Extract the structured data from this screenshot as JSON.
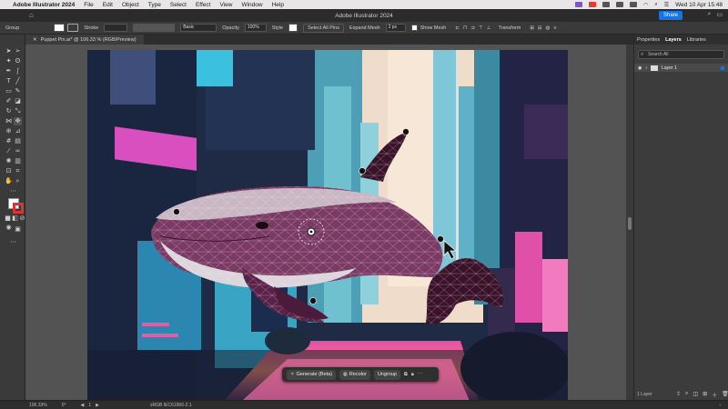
{
  "menubar": {
    "app_name": "Adobe Illustrator 2024",
    "items": [
      "File",
      "Edit",
      "Object",
      "Type",
      "Select",
      "Effect",
      "View",
      "Window",
      "Help"
    ],
    "clock": "Wed 10 Apr  15:48"
  },
  "titlebar": {
    "title": "Adobe Illustrator 2024",
    "share_label": "Share"
  },
  "controlbar": {
    "selection_label": "Group",
    "stroke_label": "Stroke",
    "brush_label": "Basic",
    "opacity_label": "Opacity",
    "opacity_value": "100%",
    "style_label": "Style",
    "select_all_pins": "Select All Pins",
    "expand_mesh_label": "Expand Mesh",
    "expand_mesh_value": "2 px",
    "show_mesh_label": "Show Mesh",
    "transform_label": "Transform"
  },
  "document_tab": {
    "name": "Puppet Pin.ai* @ 106.33 % (RGB/Preview)"
  },
  "panel": {
    "tabs": [
      "Properties",
      "Layers",
      "Libraries"
    ],
    "active_tab": "Layers",
    "search_placeholder": "Search All",
    "layer_name": "Layer 1",
    "layer_count": "1 Layer"
  },
  "taskbar": {
    "generate_label": "Generate (Beta)",
    "recolor_label": "Recolor",
    "ungroup_label": "Ungroup"
  },
  "statusbar": {
    "zoom": "106.33%",
    "angle": "0°",
    "artboard_number": "1",
    "color_profile": "sRGB IEC61966-2.1"
  },
  "colors": {
    "accent": "#1473e6",
    "whale_body": "#7a3a63",
    "whale_dark": "#3a1229",
    "whale_belly": "#dcd6dc"
  }
}
